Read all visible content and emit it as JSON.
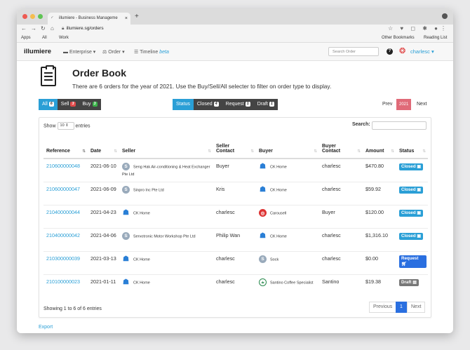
{
  "browser": {
    "tab_title": "illumiere - Business Manageme",
    "url": "illumiere.sg/orders",
    "bookmarks": [
      "Apps",
      "All",
      "Work"
    ],
    "bookmarks_right": [
      "Other Bookmarks",
      "Reading List"
    ]
  },
  "navbar": {
    "brand": "illumiere",
    "enterprise": "Enterprise",
    "order": "Order",
    "timeline": "Timeline",
    "timeline_badge": "beta",
    "search_placeholder": "Search Order",
    "help": "?",
    "user": "charlesc"
  },
  "header": {
    "title": "Order Book",
    "subtitle": "There are 6 orders for the year of 2021. Use the Buy/Sell/All selecter to filter on order type to display."
  },
  "type_filter": [
    {
      "label": "All",
      "count": "6"
    },
    {
      "label": "Sell",
      "count": "3"
    },
    {
      "label": "Buy",
      "count": "3"
    }
  ],
  "status_filter": {
    "label": "Status",
    "items": [
      {
        "label": "Closed",
        "count": "4"
      },
      {
        "label": "Request",
        "count": "1"
      },
      {
        "label": "Draft",
        "count": "1"
      }
    ]
  },
  "year_pager": {
    "prev": "Prev",
    "year": "2021",
    "next": "Next"
  },
  "table": {
    "show": "Show",
    "length": "10",
    "entries": "entries",
    "search_label": "Search:",
    "columns": [
      "Reference",
      "Date",
      "Seller",
      "Seller Contact",
      "Buyer",
      "Buyer Contact",
      "Amount",
      "Status"
    ],
    "rows": [
      {
        "reference": "210600000048",
        "date": "2021-06-10",
        "seller": "Seng Hak Air-conditioning & Heat Exchanger Pte Ltd",
        "seller_icon": "S",
        "seller_contact": "Buyer",
        "buyer": "CK Home",
        "buyer_icon": "home",
        "buyer_contact": "charlesc",
        "amount": "$470.80",
        "status": "Closed"
      },
      {
        "reference": "210600000047",
        "date": "2021-06-09",
        "seller": "Sinpro Inc Pte Ltd",
        "seller_icon": "S",
        "seller_contact": "Kris",
        "buyer": "CK Home",
        "buyer_icon": "home",
        "buyer_contact": "charlesc",
        "amount": "$59.92",
        "status": "Closed"
      },
      {
        "reference": "210400000044",
        "date": "2021-04-23",
        "seller": "CK Home",
        "seller_icon": "home",
        "seller_contact": "charlesc",
        "buyer": "Carousell",
        "buyer_icon": "carousell",
        "buyer_contact": "Buyer",
        "amount": "$120.00",
        "status": "Closed"
      },
      {
        "reference": "210400000042",
        "date": "2021-04-06",
        "seller": "Servotronic Motor Workshop Pte Ltd",
        "seller_icon": "S",
        "seller_contact": "Philip Wan",
        "buyer": "CK Home",
        "buyer_icon": "home",
        "buyer_contact": "charlesc",
        "amount": "$1,316.10",
        "status": "Closed"
      },
      {
        "reference": "210300000039",
        "date": "2021-03-13",
        "seller": "CK Home",
        "seller_icon": "home",
        "seller_contact": "charlesc",
        "buyer": "Sock",
        "buyer_icon": "S",
        "buyer_contact": "charlesc",
        "amount": "$0.00",
        "status": "Request"
      },
      {
        "reference": "210100000023",
        "date": "2021-01-11",
        "seller": "CK Home",
        "seller_icon": "home",
        "seller_contact": "charlesc",
        "buyer": "Santino Coffee Specialist",
        "buyer_icon": "santino",
        "buyer_contact": "Santino",
        "amount": "$19.38",
        "status": "Draft"
      }
    ],
    "info": "Showing 1 to 6 of 6 entries",
    "pagination": {
      "previous": "Previous",
      "page": "1",
      "next": "Next"
    }
  },
  "footer": {
    "export": "Export"
  },
  "colors": {
    "accent": "#2a9fd6",
    "closed": "#2a9fd6",
    "request": "#2a6fe0",
    "draft": "#777777",
    "year_active": "#e06a78"
  }
}
